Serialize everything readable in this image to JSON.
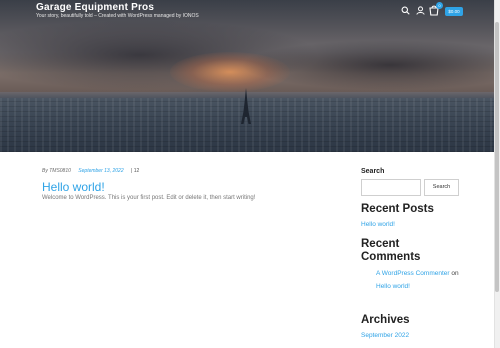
{
  "header": {
    "site_title": "Garage Equipment Pros",
    "tagline": "Your story, beautifully told – Created with WordPress managed by IONOS",
    "icons": [
      "search-icon",
      "user-icon",
      "cart-icon"
    ],
    "cart_count": "0",
    "cart_total": "$0.00"
  },
  "post": {
    "author": "By TMS0810",
    "date": "September 13, 2022",
    "comments": "| 12",
    "title": "Hello world!",
    "excerpt": "Welcome to WordPress. This is your first post. Edit or delete it, then start writing!"
  },
  "sidebar": {
    "search_label": "Search",
    "search_placeholder": "",
    "search_button": "Search",
    "recent_posts_heading": "Recent Posts",
    "recent_post": "Hello world!",
    "recent_comments_heading": "Recent Comments",
    "comment_author": "A WordPress Commenter",
    "comment_on": "on",
    "comment_post": "Hello world!",
    "archives_heading": "Archives",
    "archive_item": "September 2022"
  },
  "colors": {
    "accent": "#2fa3e6",
    "heading": "#222222",
    "text": "#777777"
  }
}
